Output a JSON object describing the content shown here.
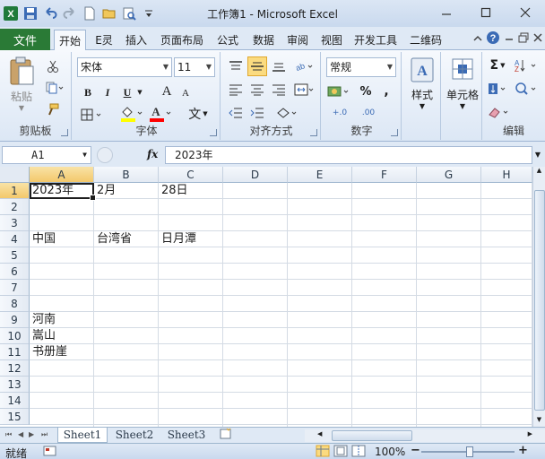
{
  "window": {
    "title": "工作簿1 - Microsoft Excel",
    "controls": [
      "minimize-icon",
      "maximize-icon",
      "close-icon"
    ]
  },
  "quick_access": [
    "excel-logo-icon",
    "save-icon",
    "undo-icon",
    "redo-icon",
    "new-icon",
    "open-icon",
    "print-preview-icon",
    "customize-icon"
  ],
  "tabs": {
    "file": "文件",
    "items": [
      "开始",
      "E灵",
      "插入",
      "页面布局",
      "公式",
      "数据",
      "审阅",
      "视图",
      "开发工具",
      "二维码"
    ],
    "active": "开始"
  },
  "ribbon": {
    "clipboard": {
      "paste": "粘贴",
      "label": "剪贴板"
    },
    "font": {
      "name": "宋体",
      "size": "11",
      "bold": "B",
      "italic": "I",
      "underline": "U",
      "grow": "A",
      "shrink": "A",
      "phonetic": "文",
      "label": "字体"
    },
    "alignment": {
      "label": "对齐方式"
    },
    "number": {
      "format": "常规",
      "percent": "%",
      "comma": ",",
      "inc_decimal": "+.0",
      "dec_decimal": ".00",
      "label": "数字"
    },
    "styles": {
      "label": "样式"
    },
    "cells": {
      "label": "单元格"
    },
    "editing": {
      "sum": "Σ",
      "label": "编辑"
    },
    "accent_color": "#2a7a36",
    "fill_color": "#ffff00",
    "font_color": "#ff0000"
  },
  "formula_bar": {
    "name_box": "A1",
    "fx": "fx",
    "value": "2023年"
  },
  "sheet": {
    "columns": [
      "A",
      "B",
      "C",
      "D",
      "E",
      "F",
      "G",
      "H"
    ],
    "rows": [
      "1",
      "2",
      "3",
      "4",
      "5",
      "6",
      "7",
      "8",
      "9",
      "10",
      "11",
      "12",
      "13",
      "14",
      "15"
    ],
    "selected_cell": "A1",
    "cells": [
      {
        "ref": "A1",
        "value": "2023年"
      },
      {
        "ref": "B1",
        "value": "2月"
      },
      {
        "ref": "C1",
        "value": "28日"
      },
      {
        "ref": "A4",
        "value": "中国"
      },
      {
        "ref": "B4",
        "value": "台湾省"
      },
      {
        "ref": "C4",
        "value": "日月潭"
      },
      {
        "ref": "A9",
        "value": "河南"
      },
      {
        "ref": "A10",
        "value": "嵩山"
      },
      {
        "ref": "A11",
        "value": "书册崖"
      }
    ]
  },
  "sheet_tabs": [
    "Sheet1",
    "Sheet2",
    "Sheet3"
  ],
  "active_sheet": "Sheet1",
  "status": {
    "ready": "就绪",
    "zoom": "100%",
    "zoom_out": "−",
    "zoom_in": "+"
  }
}
